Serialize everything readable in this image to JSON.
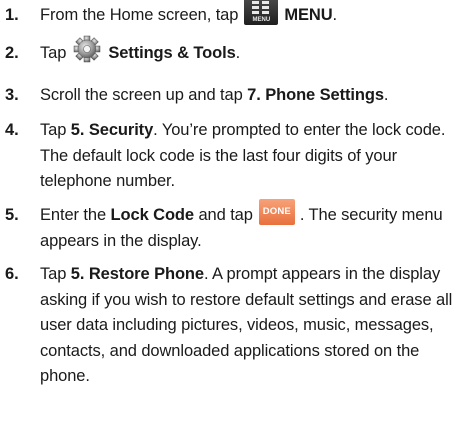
{
  "steps": [
    {
      "number": "1.",
      "before": "From the Home screen, tap",
      "icon_name": "menu-icon",
      "icon_caption": "MENU",
      "bold": "MENU",
      "after": "."
    },
    {
      "number": "2.",
      "before": "Tap",
      "icon_name": "settings-gear-icon",
      "bold": "Settings & Tools",
      "after": "."
    },
    {
      "number": "3.",
      "before": "Scroll the screen up and tap ",
      "bold": "7. Phone Settings",
      "after": "."
    },
    {
      "number": "4.",
      "before": "Tap ",
      "bold": "5. Security",
      "after_lines": [
        ". You’re prompted to enter the lock code.",
        "The default lock code is the last four digits of your",
        "telephone number."
      ]
    },
    {
      "number": "5.",
      "before": "Enter the ",
      "bold": "Lock Code",
      "middle": " and tap",
      "icon_name": "done-icon",
      "icon_caption": "DONE",
      "after_lines": [
        ". The security menu",
        "appears in the display."
      ]
    },
    {
      "number": "6.",
      "before": "Tap ",
      "bold": "5. Restore Phone",
      "after_lines": [
        ". A prompt appears in the display",
        "asking if you wish to restore default settings and erase all",
        "user data including pictures, videos, music, messages,",
        "contacts, and downloaded applications stored on the",
        "phone."
      ]
    }
  ],
  "colors": {
    "text": "#1a1a1a",
    "menu_icon_bg": "#2e2e2e",
    "done_button_bg": "#ee7f4c",
    "done_button_text": "#ffffff"
  }
}
